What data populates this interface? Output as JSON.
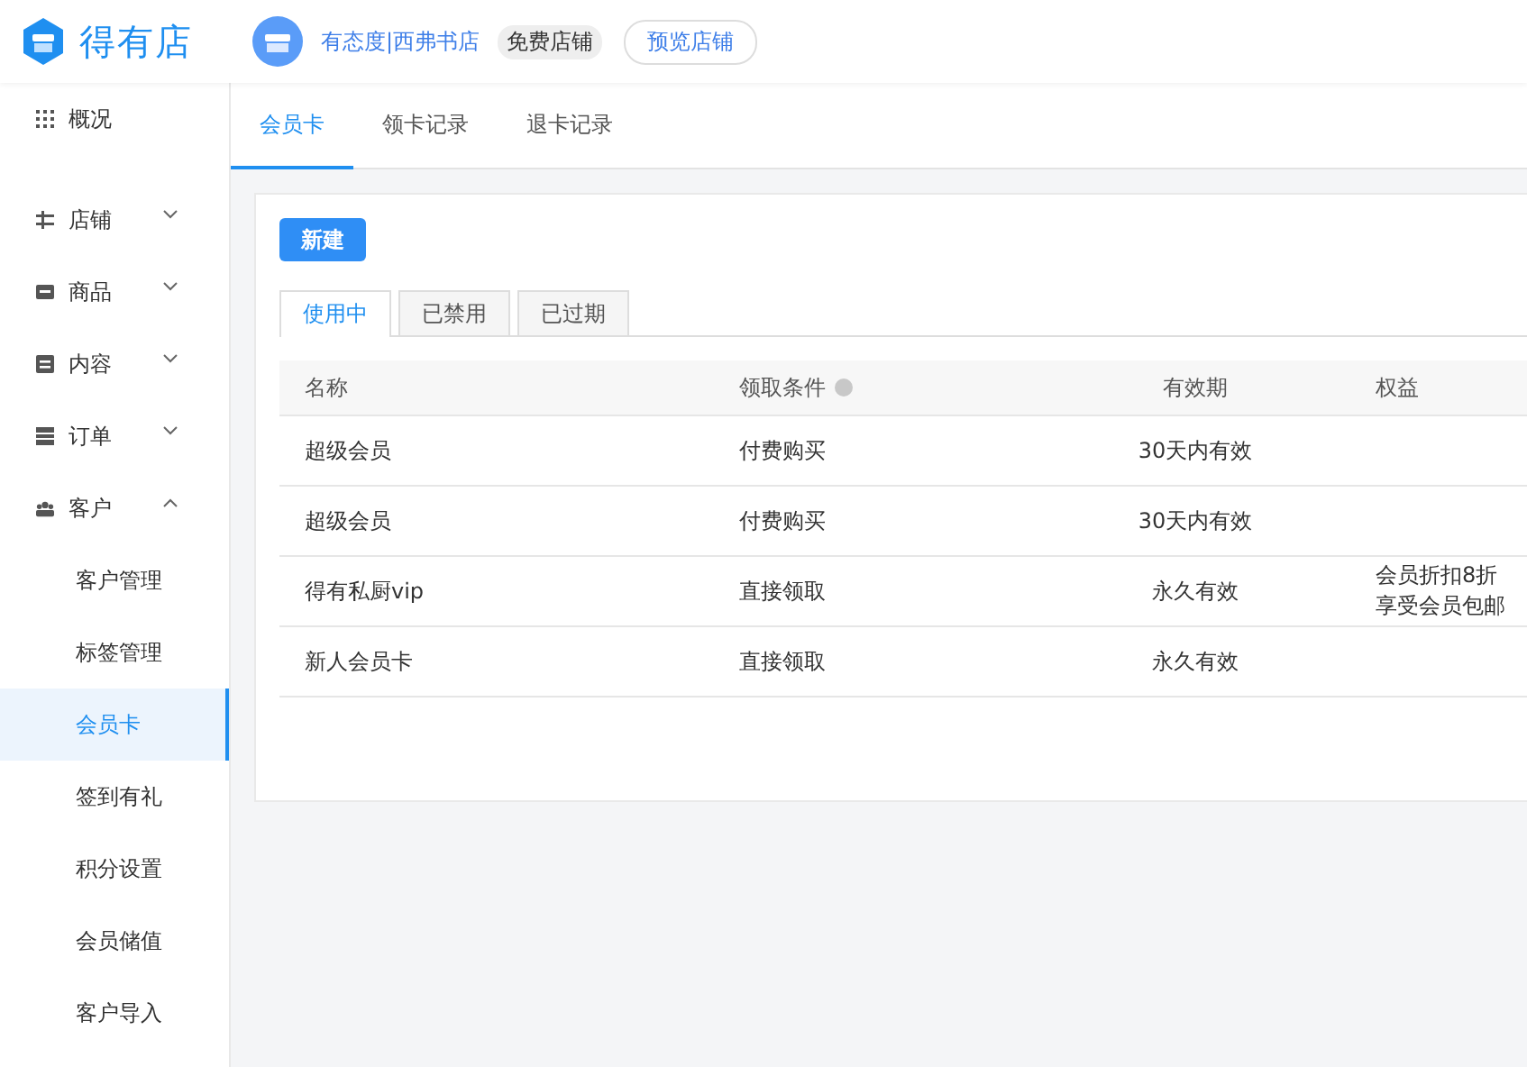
{
  "header": {
    "brand": "得有店",
    "shop_name": "有态度|西弗书店",
    "plan_badge": "免费店铺",
    "preview_button": "预览店铺"
  },
  "sidebar": {
    "items": [
      {
        "kind": "top",
        "label": "概况"
      },
      {
        "kind": "group",
        "label": "店铺",
        "expanded": false
      },
      {
        "kind": "group",
        "label": "商品",
        "expanded": false
      },
      {
        "kind": "group",
        "label": "内容",
        "expanded": false
      },
      {
        "kind": "group",
        "label": "订单",
        "expanded": false
      },
      {
        "kind": "group",
        "label": "客户",
        "expanded": true,
        "children": [
          {
            "label": "客户管理",
            "selected": false
          },
          {
            "label": "标签管理",
            "selected": false
          },
          {
            "label": "会员卡",
            "selected": true
          },
          {
            "label": "签到有礼",
            "selected": false
          },
          {
            "label": "积分设置",
            "selected": false
          },
          {
            "label": "会员储值",
            "selected": false
          },
          {
            "label": "客户导入",
            "selected": false
          }
        ]
      }
    ]
  },
  "tabs": [
    {
      "label": "会员卡",
      "selected": true
    },
    {
      "label": "领卡记录",
      "selected": false
    },
    {
      "label": "退卡记录",
      "selected": false
    }
  ],
  "new_button": "新建",
  "status_tabs": [
    {
      "label": "使用中",
      "selected": true
    },
    {
      "label": "已禁用",
      "selected": false
    },
    {
      "label": "已过期",
      "selected": false
    }
  ],
  "table": {
    "columns": [
      "名称",
      "领取条件",
      "有效期",
      "权益"
    ],
    "rows": [
      [
        "超级会员",
        "付费购买",
        "30天内有效",
        null
      ],
      [
        "超级会员",
        "付费购买",
        "30天内有效",
        null
      ],
      [
        "得有私厨vip",
        "直接领取",
        "永久有效",
        [
          "会员折扣8折",
          "享受会员包邮"
        ]
      ],
      [
        "新人会员卡",
        "直接领取",
        "永久有效",
        null
      ]
    ]
  }
}
